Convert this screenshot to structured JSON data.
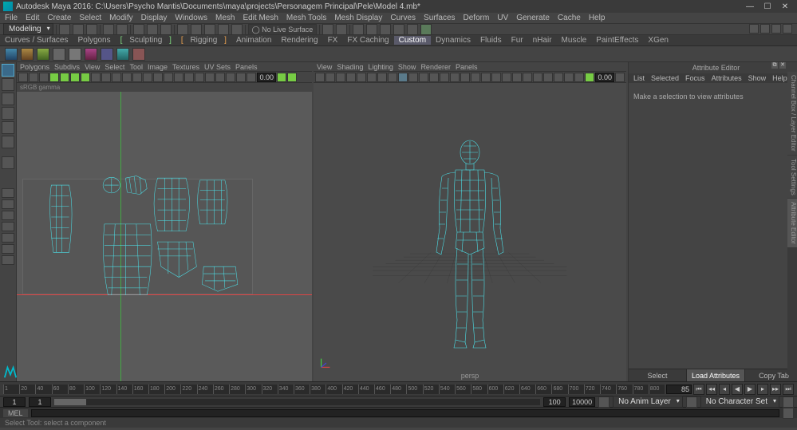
{
  "titlebar": {
    "text": "Autodesk Maya 2016: C:\\Users\\Psycho Mantis\\Documents\\maya\\projects\\Personagem Principal\\Pele\\Model 4.mb*"
  },
  "main_menu": [
    "File",
    "Edit",
    "Create",
    "Select",
    "Modify",
    "Display",
    "Windows",
    "Mesh",
    "Edit Mesh",
    "Mesh Tools",
    "Mesh Display",
    "Curves",
    "Surfaces",
    "Deform",
    "UV",
    "Generate",
    "Cache",
    "Help"
  ],
  "menuset": "Modeling",
  "live_surface_label": "No Live Surface",
  "sym_value": "0.00",
  "module_tabs": [
    "Curves / Surfaces",
    "Polygons",
    "Sculpting",
    "Rigging",
    "Animation",
    "Rendering",
    "FX",
    "FX Caching",
    "Custom",
    "Dynamics",
    "Fluids",
    "Fur",
    "nHair",
    "Muscle",
    "PaintEffects",
    "XGen"
  ],
  "module_active": "Custom",
  "left_panel": {
    "menu": [
      "Polygons",
      "Subdivs",
      "View",
      "Select",
      "Tool",
      "Image",
      "Textures",
      "UV Sets",
      "Panels"
    ],
    "tool_values": {
      "soft": "0.00"
    },
    "gamma_label": "sRGB gamma"
  },
  "right_panel": {
    "menu": [
      "View",
      "Shading",
      "Lighting",
      "Show",
      "Renderer",
      "Panels"
    ],
    "tool_value": "0.00",
    "camera": "persp"
  },
  "attribute_editor": {
    "title": "Attribute Editor",
    "tabs": [
      "List",
      "Selected",
      "Focus",
      "Attributes",
      "Show",
      "Help"
    ],
    "message": "Make a selection to view attributes",
    "buttons": {
      "select": "Select",
      "load": "Load Attributes",
      "copy": "Copy Tab"
    }
  },
  "side_tabs": [
    "Channel Box / Layer Editor",
    "Tool Settings",
    "Attribute Editor"
  ],
  "timeline": {
    "ticks": [
      "1",
      "20",
      "40",
      "60",
      "80",
      "100",
      "120",
      "140",
      "160",
      "180",
      "200",
      "220",
      "240",
      "260",
      "280",
      "300",
      "320",
      "340",
      "360",
      "380",
      "400",
      "420",
      "440",
      "460",
      "480",
      "500",
      "520",
      "540",
      "560",
      "580",
      "600",
      "620",
      "640",
      "660",
      "680",
      "700",
      "720",
      "740",
      "760",
      "780",
      "800",
      "85"
    ],
    "current_frame": "85"
  },
  "range": {
    "start_out": "1",
    "start_in": "1",
    "end_in": "100",
    "end_out": "10000",
    "anim_layer": "No Anim Layer",
    "char_set": "No Character Set"
  },
  "command": {
    "lang": "MEL"
  },
  "helpline": "Select Tool: select a component"
}
